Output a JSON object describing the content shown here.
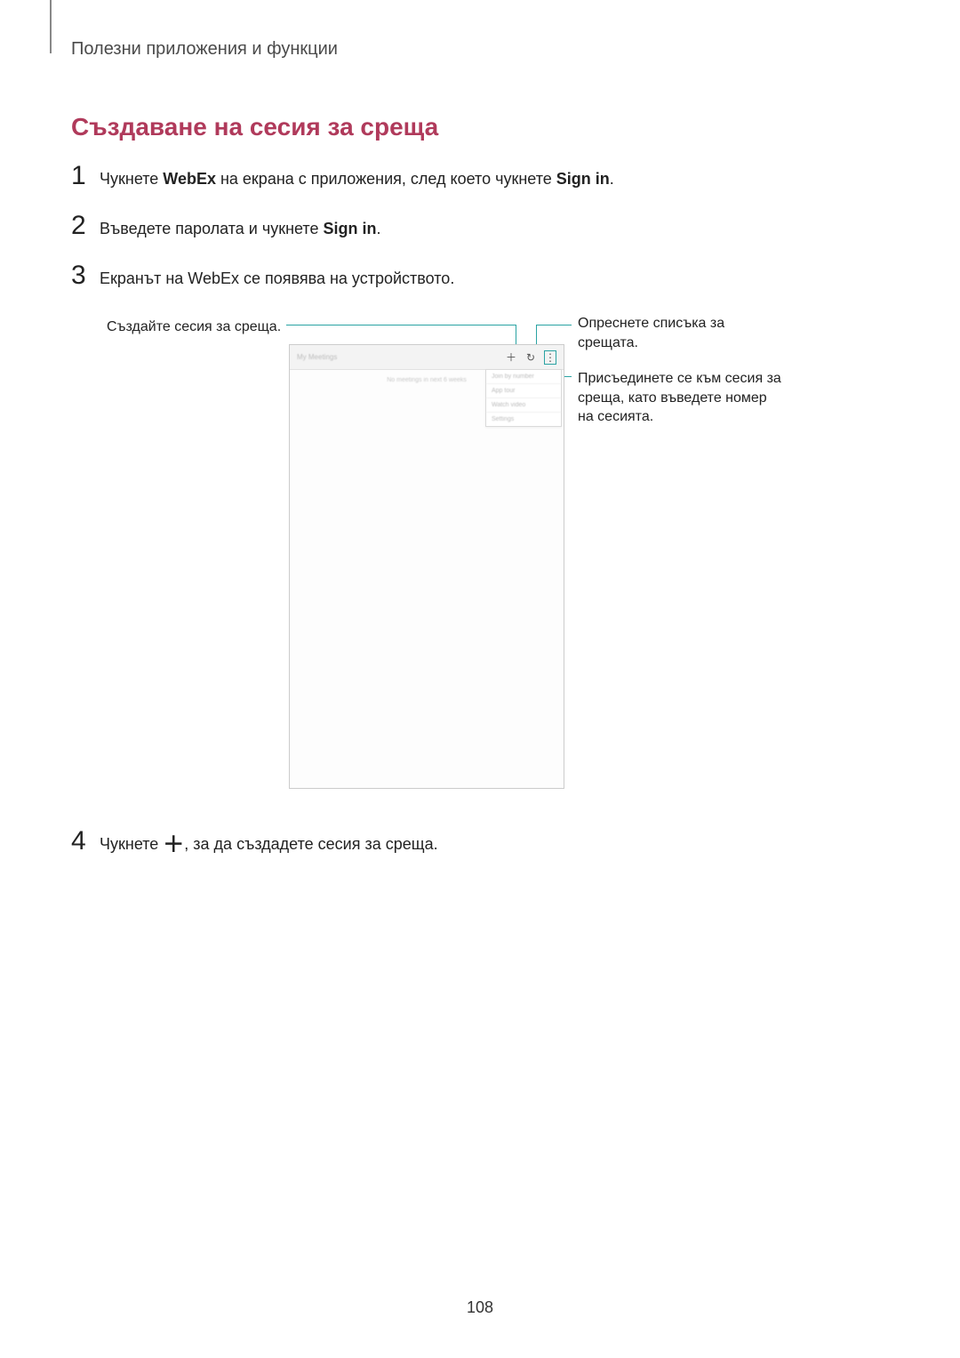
{
  "header": {
    "title": "Полезни приложения и функции"
  },
  "section": {
    "title": "Създаване на сесия за среща"
  },
  "steps": {
    "s1": {
      "num": "1",
      "pre": "Чукнете ",
      "bold1": "WebEx",
      "mid": " на екрана с приложения, след което чукнете ",
      "bold2": "Sign in",
      "post": "."
    },
    "s2": {
      "num": "2",
      "pre": "Въведете паролата и чукнете ",
      "bold1": "Sign in",
      "post": "."
    },
    "s3": {
      "num": "3",
      "text": "Екранът на WebEx се появява на устройството."
    },
    "s4": {
      "num": "4",
      "pre": "Чукнете ",
      "post": ", за да създадете сесия за среща."
    }
  },
  "callouts": {
    "create": "Създайте сесия за среща.",
    "refresh": "Опреснете списъка за срещата.",
    "join": "Присъединете се към сесия за среща, като въведете номер на сесията."
  },
  "device": {
    "title": "My Meetings",
    "empty": "No meetings in next 6 weeks",
    "menu": {
      "i1": "Join by number",
      "i2": "App tour",
      "i3": "Watch video",
      "i4": "Settings"
    }
  },
  "page_number": "108"
}
